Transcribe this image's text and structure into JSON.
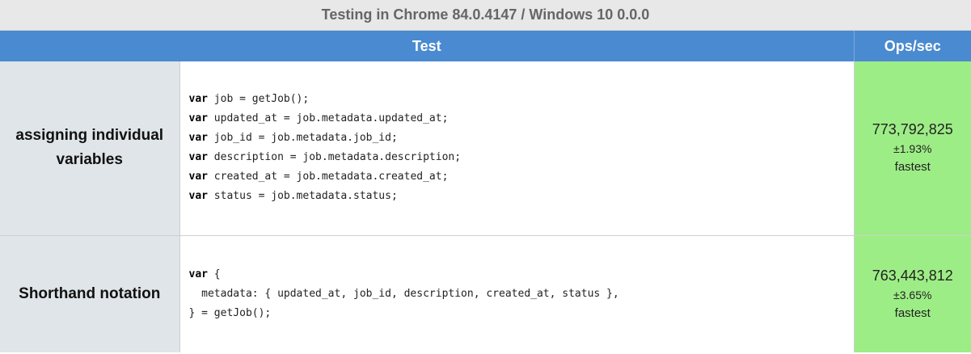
{
  "header": {
    "title": "Testing in Chrome 84.0.4147 / Windows 10 0.0.0"
  },
  "table": {
    "columns": {
      "test": "Test",
      "ops": "Ops/sec"
    },
    "rows": [
      {
        "name_line1": "assigning individual",
        "name_line2": "variables",
        "code": [
          {
            "kw": "var",
            "rest": " job = getJob();"
          },
          {
            "kw": "var",
            "rest": " updated_at = job.metadata.updated_at;"
          },
          {
            "kw": "var",
            "rest": " job_id = job.metadata.job_id;"
          },
          {
            "kw": "var",
            "rest": " description = job.metadata.description;"
          },
          {
            "kw": "var",
            "rest": " created_at = job.metadata.created_at;"
          },
          {
            "kw": "var",
            "rest": " status = job.metadata.status;"
          }
        ],
        "ops_value": "773,792,825",
        "ops_error": "±1.93%",
        "ops_status": "fastest"
      },
      {
        "name_line1": "Shorthand notation",
        "code": [
          {
            "kw": "var",
            "rest": " {"
          },
          {
            "kw": "",
            "rest": "  metadata: { updated_at, job_id, description, created_at, status },"
          },
          {
            "kw": "",
            "rest": "} = getJob();"
          }
        ],
        "ops_value": "763,443,812",
        "ops_error": "±3.65%",
        "ops_status": "fastest"
      }
    ]
  },
  "colors": {
    "header_blue": "#4a8ad0",
    "fastest_green": "#9ded86",
    "name_cell_gray": "#dfe5e8"
  }
}
